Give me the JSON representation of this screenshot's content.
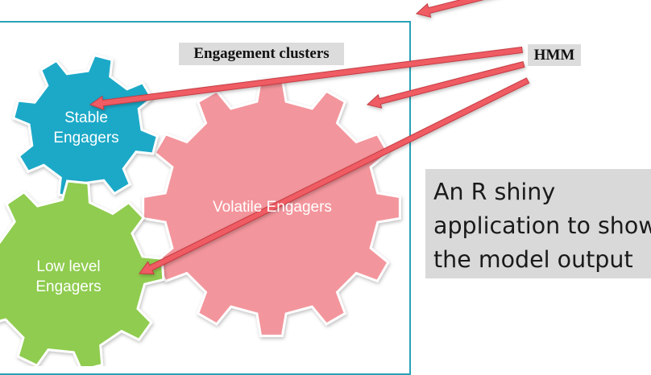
{
  "diagram": {
    "title": "Engagement clusters",
    "source_label": "HMM",
    "note": "An R shiny\napplication to show\nthe model output",
    "clusters": [
      {
        "id": "stable",
        "label": "Stable\nEngagers",
        "color": "#1aa9c8"
      },
      {
        "id": "volatile",
        "label": "Volatile Engagers",
        "color": "#f3959c"
      },
      {
        "id": "low",
        "label": "Low level\nEngagers",
        "color": "#8fcc4f"
      }
    ],
    "colors": {
      "frame": "#2aa1b7",
      "arrow": "#ef5b63",
      "label_background": "#dcdcdc"
    }
  }
}
